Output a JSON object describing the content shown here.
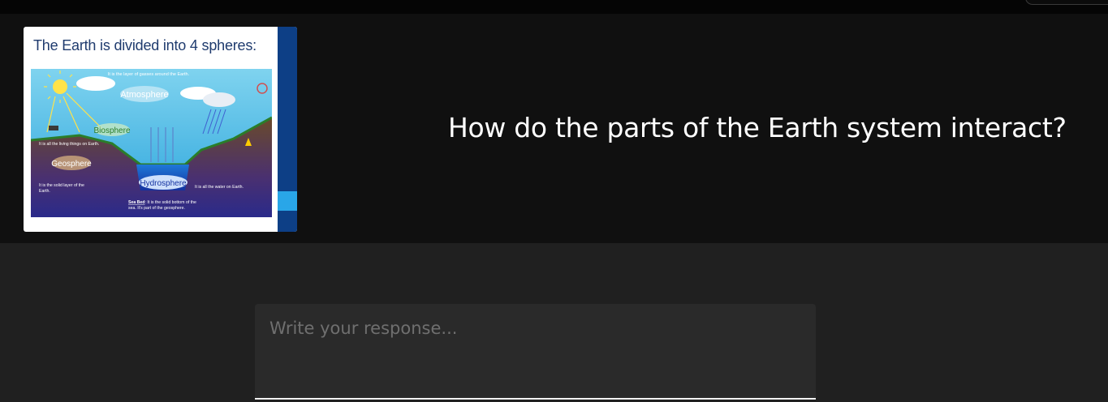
{
  "question": {
    "text": "How do the parts of the Earth system interact?"
  },
  "slide": {
    "title": "The Earth is divided into 4 spheres:",
    "atmosphere_desc": "It is the layer of gasses around the Earth.",
    "atmosphere_label": "Atmosphere",
    "biosphere_label": "Biosphere",
    "biosphere_desc": "It is all the living things on Earth.",
    "geosphere_label": "Geosphere",
    "geosphere_desc_1": "It is the solid layer of the",
    "geosphere_desc_2": "Earth.",
    "hydrosphere_label": "Hydrosphere",
    "hydrosphere_desc": "It is all the water on Earth.",
    "seabed_term": "Sea Bed",
    "seabed_desc_1": ": It is the solid bottom of the",
    "seabed_desc_2": "sea. It's part of the geosphere."
  },
  "response": {
    "placeholder": "Write your response..."
  },
  "colors": {
    "page_bg": "#202020",
    "panel_bg": "#101010",
    "input_bg": "#2a2a2a",
    "slide_title": "#1f3b6e",
    "slide_sidebar": "#0d3f86"
  }
}
